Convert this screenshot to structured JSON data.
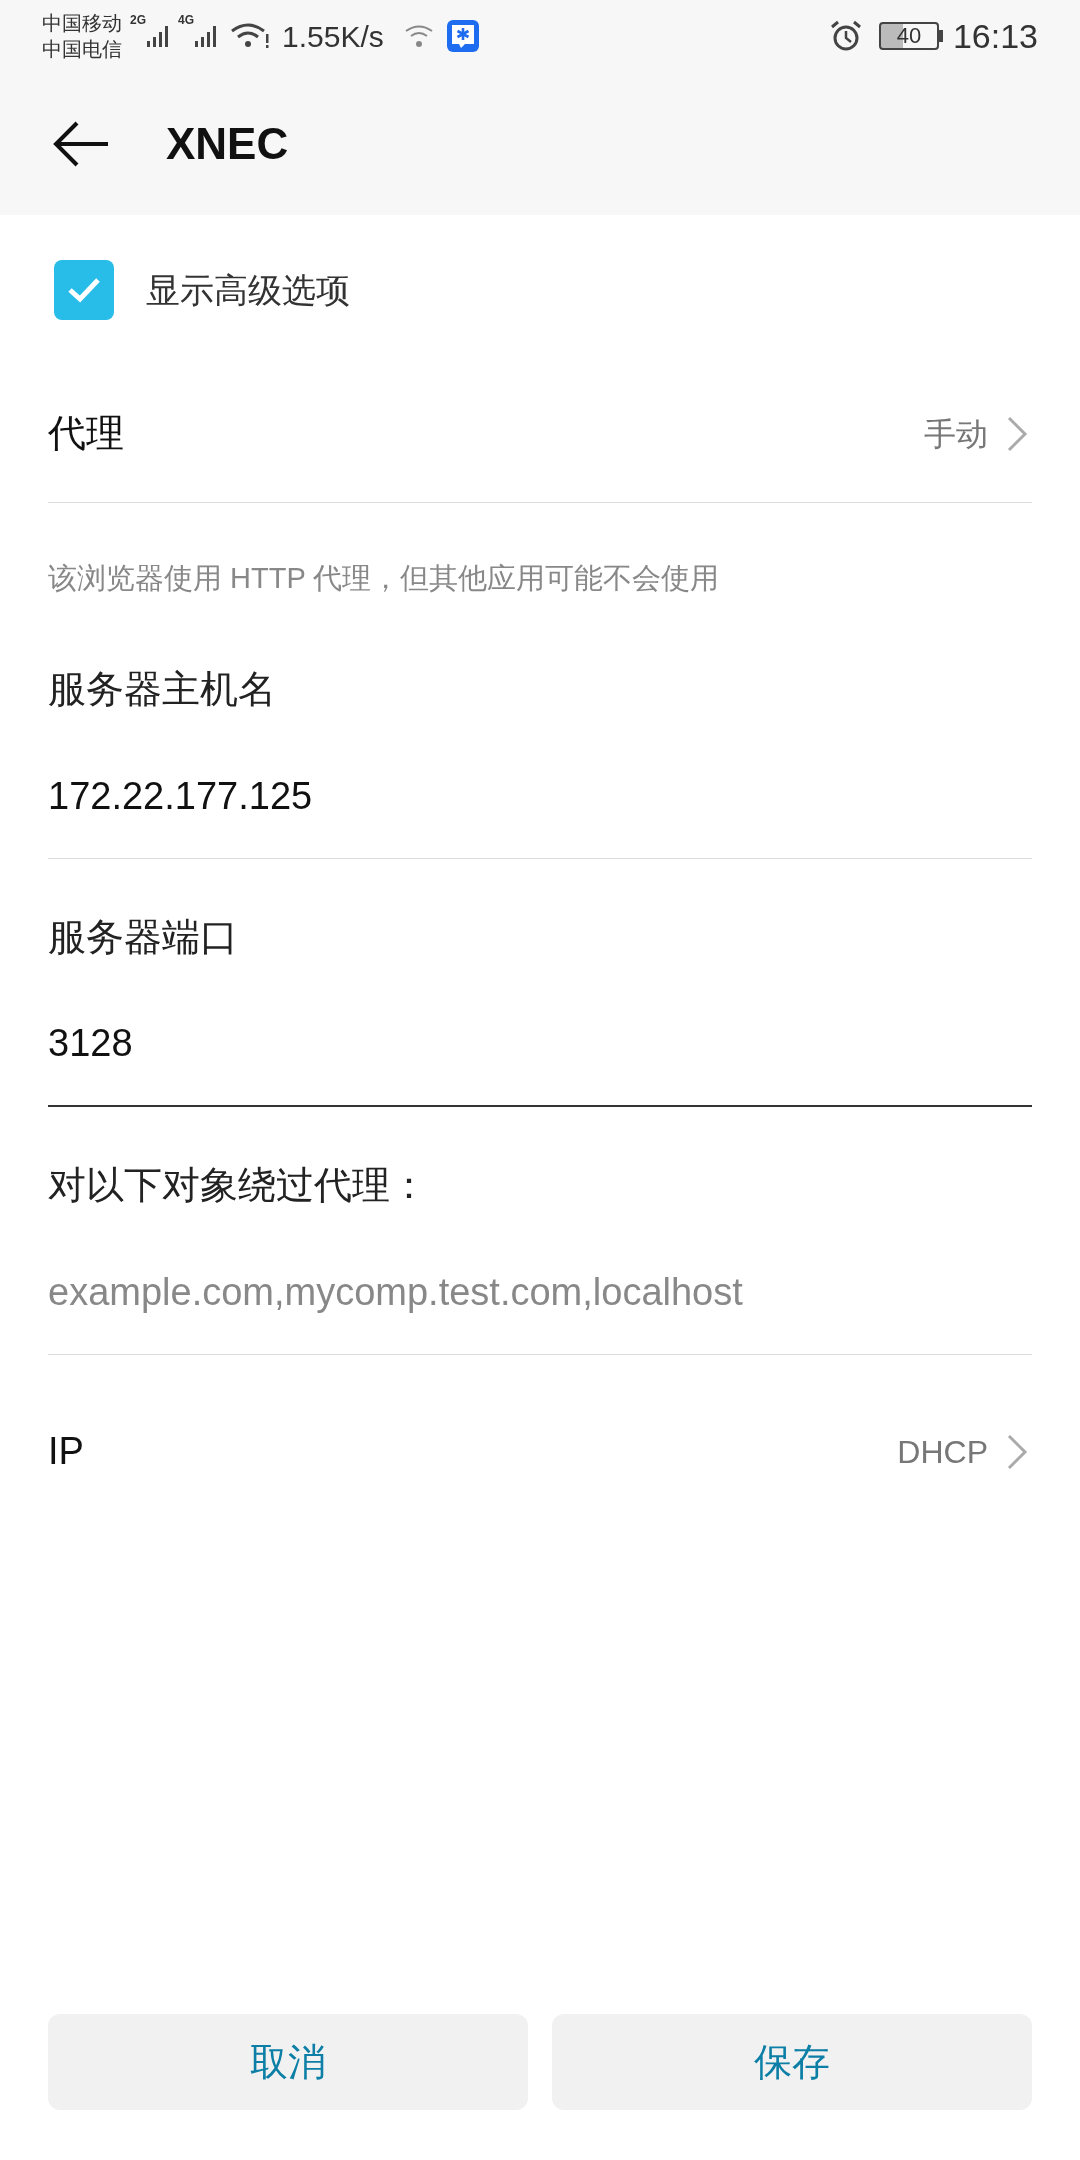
{
  "status_bar": {
    "carriers": [
      "中国移动",
      "中国电信"
    ],
    "signal_labels": [
      "2G",
      "4G"
    ],
    "speed": "1.55K/s",
    "battery": "40",
    "time": "16:13"
  },
  "header": {
    "title": "XNEC"
  },
  "advanced": {
    "label": "显示高级选项",
    "checked": true
  },
  "proxy": {
    "label": "代理",
    "value": "手动"
  },
  "hint": "该浏览器使用 HTTP 代理，但其他应用可能不会使用",
  "fields": [
    {
      "label": "服务器主机名",
      "value": "172.22.177.125",
      "focused": false
    },
    {
      "label": "服务器端口",
      "value": "3128",
      "focused": true
    },
    {
      "label": "对以下对象绕过代理：",
      "placeholder": "example.com,mycomp.test.com,localhost",
      "focused": false
    }
  ],
  "ip": {
    "label": "IP",
    "value": "DHCP"
  },
  "buttons": [
    "取消",
    "保存"
  ]
}
